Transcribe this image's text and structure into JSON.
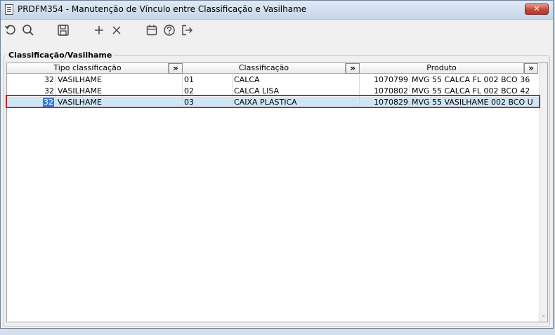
{
  "window": {
    "title": "PRDFM354 - Manutenção de Vínculo entre Classificação e Vasilhame",
    "close_glyph": "✕"
  },
  "toolbar": {
    "buttons": [
      {
        "name": "refresh-icon"
      },
      {
        "name": "search-icon"
      },
      {
        "name": "save-icon"
      },
      {
        "name": "add-icon"
      },
      {
        "name": "delete-icon"
      },
      {
        "name": "calendar-icon"
      },
      {
        "name": "help-icon"
      },
      {
        "name": "exit-icon"
      }
    ]
  },
  "group": {
    "label": "Classificação/Vasilhame"
  },
  "grid": {
    "headers": {
      "tipo": "Tipo classificação",
      "classificacao": "Classificação",
      "produto": "Produto",
      "expand": "»"
    },
    "rows": [
      {
        "tipo_code": "32",
        "tipo_desc": "VASILHAME",
        "class_code": "01",
        "class_desc": "CALCA",
        "prod_code": "1070799",
        "prod_desc": "MVG 55 CALCA FL 002 BCO 36"
      },
      {
        "tipo_code": "32",
        "tipo_desc": "VASILHAME",
        "class_code": "02",
        "class_desc": "CALCA LISA",
        "prod_code": "1070802",
        "prod_desc": "MVG 55 CALCA FL 002 BCO 42"
      },
      {
        "tipo_code": "32",
        "tipo_desc": "VASILHAME",
        "class_code": "03",
        "class_desc": "CAIXA PLASTICA",
        "prod_code": "1070829",
        "prod_desc": "MVG 55 VASILHAME 002 BCO U"
      }
    ],
    "selected_row": 2
  },
  "colors": {
    "selection_outline": "#c0282b",
    "selected_row": "#cfe6f7",
    "cell_highlight": "#3a78d8"
  }
}
